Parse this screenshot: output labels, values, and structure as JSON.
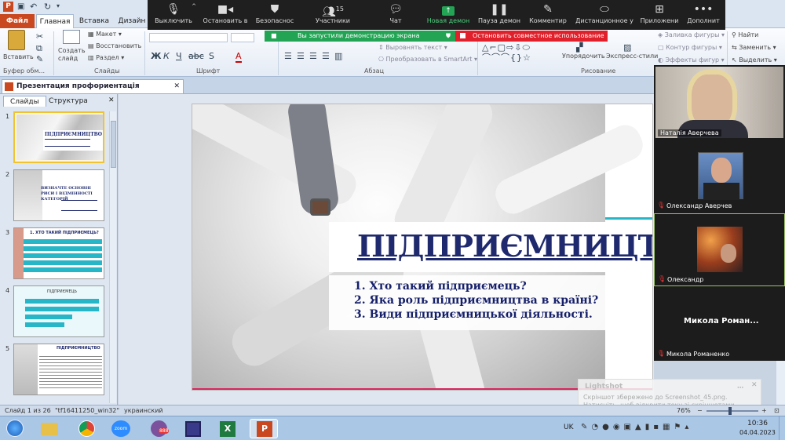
{
  "window": {
    "title": "Презентация профориентація Підприємництво",
    "close": "✕"
  },
  "ribbon_tabs": {
    "file": "Файл",
    "home": "Главная",
    "insert": "Вставка",
    "design": "Дизайн"
  },
  "ribbon": {
    "paste": "Вставить",
    "create_slide": "Создать слайд",
    "layout": "Макет",
    "restore": "Восстановить",
    "section": "Раздел",
    "text_direction": "Выровнять текст",
    "convert_smartart": "Преобразовать в SmartArt",
    "arrange": "Упорядочить",
    "quick_styles": "Экспресс-стили",
    "shape_fill": "Заливка фигуры",
    "shape_outline": "Контур фигуры",
    "shape_effects": "Эффекты фигур",
    "find": "Найти",
    "replace": "Заменить",
    "select": "Выделить",
    "groups": {
      "clipboard": "Буфер обм...",
      "slides": "Слайды",
      "font": "Шрифт",
      "paragraph": "Абзац",
      "drawing": "Рисование"
    }
  },
  "zoom_toolbar": {
    "items": [
      {
        "label": "Выключить",
        "icon": "microphone-icon"
      },
      {
        "label": "Остановить в",
        "icon": "video-camera-icon"
      },
      {
        "label": "Безопаснос",
        "icon": "shield-icon"
      },
      {
        "label": "Участники",
        "icon": "participants-icon",
        "count": "15"
      },
      {
        "label": "Чат",
        "icon": "chat-icon"
      },
      {
        "label": "Новая демон",
        "icon": "share-screen-icon"
      },
      {
        "label": "Пауза демон",
        "icon": "pause-icon"
      },
      {
        "label": "Комментир",
        "icon": "annotate-icon"
      },
      {
        "label": "Дистанционное у",
        "icon": "remote-control-icon"
      },
      {
        "label": "Приложени",
        "icon": "apps-icon"
      },
      {
        "label": "Дополнит",
        "icon": "more-icon"
      }
    ],
    "sharing_notice": "Вы запустили демонстрацию экрана",
    "stop_share": "Остановить совместное использование"
  },
  "left_panel": {
    "tabs": [
      "Слайды",
      "Структура"
    ],
    "close": "✕",
    "slides": [
      {
        "number": "1",
        "title": "ПІДПРИЄМНИЦТВО"
      },
      {
        "number": "2",
        "title": "ВИЗНАЧТЕ ОСНОВНІ РИСИ І ВІДМІННОСТІ КАТЕГОРІЙ"
      },
      {
        "number": "3",
        "title": "1. ХТО ТАКИЙ ПІДПРИЄМЕЦЬ?"
      },
      {
        "number": "4",
        "title": "ПІДПРИЄМЕЦЬ"
      },
      {
        "number": "5",
        "title": "ПІДПРИЄМНИЦТВО"
      }
    ]
  },
  "slide": {
    "title": "ПІДПРИЄМНИЦТВО",
    "items": [
      "1.  Хто такий підприємець?",
      "2.  Яка роль підприємництва в країні?",
      "3.  Види підприємницької діяльності."
    ]
  },
  "participants": [
    {
      "name": "Наталія Аверчева",
      "muted": false
    },
    {
      "name": "Олександр Аверчев",
      "muted": true
    },
    {
      "name": "Олександр",
      "muted": true
    },
    {
      "name": "Микола Романенко",
      "muted": true,
      "placeholder": "Микола  Роман..."
    }
  ],
  "statusbar": {
    "slide_counter": "Слайд 1 из 26",
    "theme": "\"tf16411250_win32\"",
    "language": "украинский",
    "zoom": "76%"
  },
  "toast": {
    "app": "Lightshot",
    "text": "Скріншот збережено до Screenshot_45.png. Натисніть, щоб відкрити теку зі скріншотами."
  },
  "taskbar": {
    "language": "UK",
    "time": "10:36",
    "date": "04.04.2023",
    "viber_badge": "888"
  },
  "colors": {
    "accent_red": "#e0212b",
    "accent_green": "#23a455",
    "slide_title": "#1f2a6e",
    "slide_text": "#16206a",
    "pink_line": "#d8245c",
    "cyan_line": "#27b6c8"
  }
}
